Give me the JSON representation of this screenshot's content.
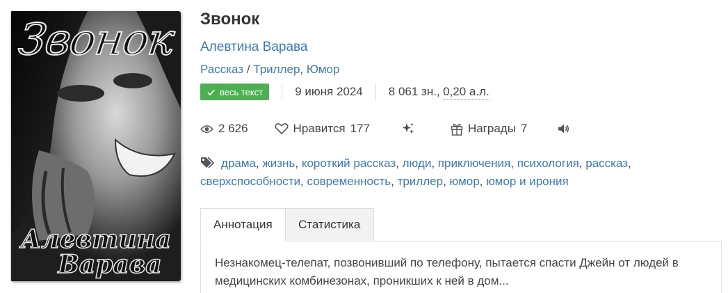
{
  "book": {
    "title": "Звонок",
    "author": "Алевтина Варава",
    "cover": {
      "title_text": "Звонок",
      "author_line1": "Алевтина",
      "author_line2": "Варава"
    },
    "form": "Рассказ",
    "genre_separator": " / ",
    "genres": [
      "Триллер",
      "Юмор"
    ],
    "status_badge": "весь текст",
    "date": "9 июня 2024",
    "size_chars": "8 061 зн.,",
    "size_sheets": "0,20 а.л."
  },
  "stats": {
    "views": "2 626",
    "likes_label": "Нравится",
    "likes_count": "177",
    "awards_label": "Награды",
    "awards_count": "7"
  },
  "tags": [
    "драма",
    "жизнь",
    "короткий рассказ",
    "люди",
    "приключения",
    "психология",
    "рассказ",
    "сверхспособности",
    "современность",
    "триллер",
    "юмор",
    "юмор и ирония"
  ],
  "tabs": [
    {
      "label": "Аннотация",
      "active": true
    },
    {
      "label": "Статистика",
      "active": false
    }
  ],
  "annotation": "Незнакомец-телепат, позвонивший по телефону, пытается спасти Джейн от людей в медицинских комбинезонах, проникших к ней в дом...",
  "colors": {
    "link": "#3a7ab3",
    "badge_green": "#4caf50",
    "text": "#333333"
  },
  "icons": [
    "eye-icon",
    "heart-icon",
    "sparkles-icon",
    "gift-icon",
    "speaker-icon",
    "tag-icon",
    "check-icon"
  ]
}
